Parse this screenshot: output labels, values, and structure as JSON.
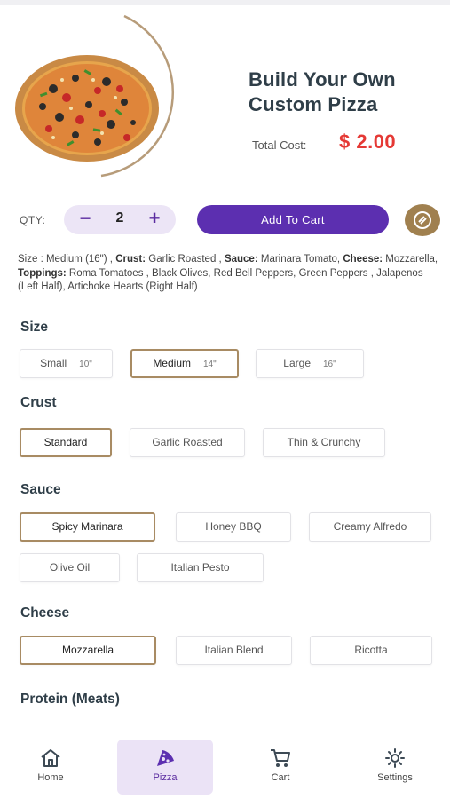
{
  "header": {
    "title": "Build Your Own Custom Pizza",
    "total_cost_label": "Total Cost:",
    "total_cost_value": "$ 2.00",
    "image_icon": "pizza-image"
  },
  "order": {
    "qty_label": "QTY:",
    "minus": "−",
    "plus": "+",
    "quantity": "2",
    "add_to_cart_label": "Add To Cart",
    "coupon_icon": "coupon-icon"
  },
  "summary": {
    "size_label": "Size :",
    "size_value": "Medium (16\") ,",
    "crust_label": "Crust:",
    "crust_value": "Garlic Roasted ,",
    "sauce_label": "Sauce:",
    "sauce_value": "Marinara Tomato,",
    "cheese_label": "Cheese:",
    "cheese_value": "Mozzarella,",
    "toppings_label": "Toppings:",
    "toppings_value": "Roma Tomatoes , Black Olives, Red Bell Peppers, Green Peppers , Jalapenos (Left Half), Artichoke Hearts (Right Half)"
  },
  "sections": {
    "size": {
      "title": "Size",
      "options": [
        {
          "label": "Small",
          "size": "10\"",
          "selected": false
        },
        {
          "label": "Medium",
          "size": "14\"",
          "selected": true
        },
        {
          "label": "Large",
          "size": "16\"",
          "selected": false
        }
      ]
    },
    "crust": {
      "title": "Crust",
      "options": [
        {
          "label": "Standard",
          "selected": true
        },
        {
          "label": "Garlic Roasted",
          "selected": false
        },
        {
          "label": "Thin & Crunchy",
          "selected": false
        }
      ]
    },
    "sauce": {
      "title": "Sauce",
      "options": [
        {
          "label": "Spicy Marinara",
          "selected": true
        },
        {
          "label": "Honey BBQ",
          "selected": false
        },
        {
          "label": "Creamy Alfredo",
          "selected": false
        },
        {
          "label": "Olive Oil",
          "selected": false
        },
        {
          "label": "Italian Pesto",
          "selected": false
        }
      ]
    },
    "cheese": {
      "title": "Cheese",
      "options": [
        {
          "label": "Mozzarella",
          "selected": true
        },
        {
          "label": "Italian Blend",
          "selected": false
        },
        {
          "label": "Ricotta",
          "selected": false
        }
      ]
    },
    "protein": {
      "title": "Protein (Meats)"
    }
  },
  "bottom_nav": {
    "items": [
      {
        "label": "Home",
        "icon": "home-icon",
        "active": false
      },
      {
        "label": "Pizza",
        "icon": "pizza-slice-icon",
        "active": true
      },
      {
        "label": "Cart",
        "icon": "cart-icon",
        "active": false
      },
      {
        "label": "Settings",
        "icon": "gear-icon",
        "active": false
      }
    ]
  },
  "colors": {
    "accent": "#5c2fb0",
    "price": "#e53935",
    "selected_border": "#a88b63",
    "stepper_bg": "#ece5f6"
  }
}
